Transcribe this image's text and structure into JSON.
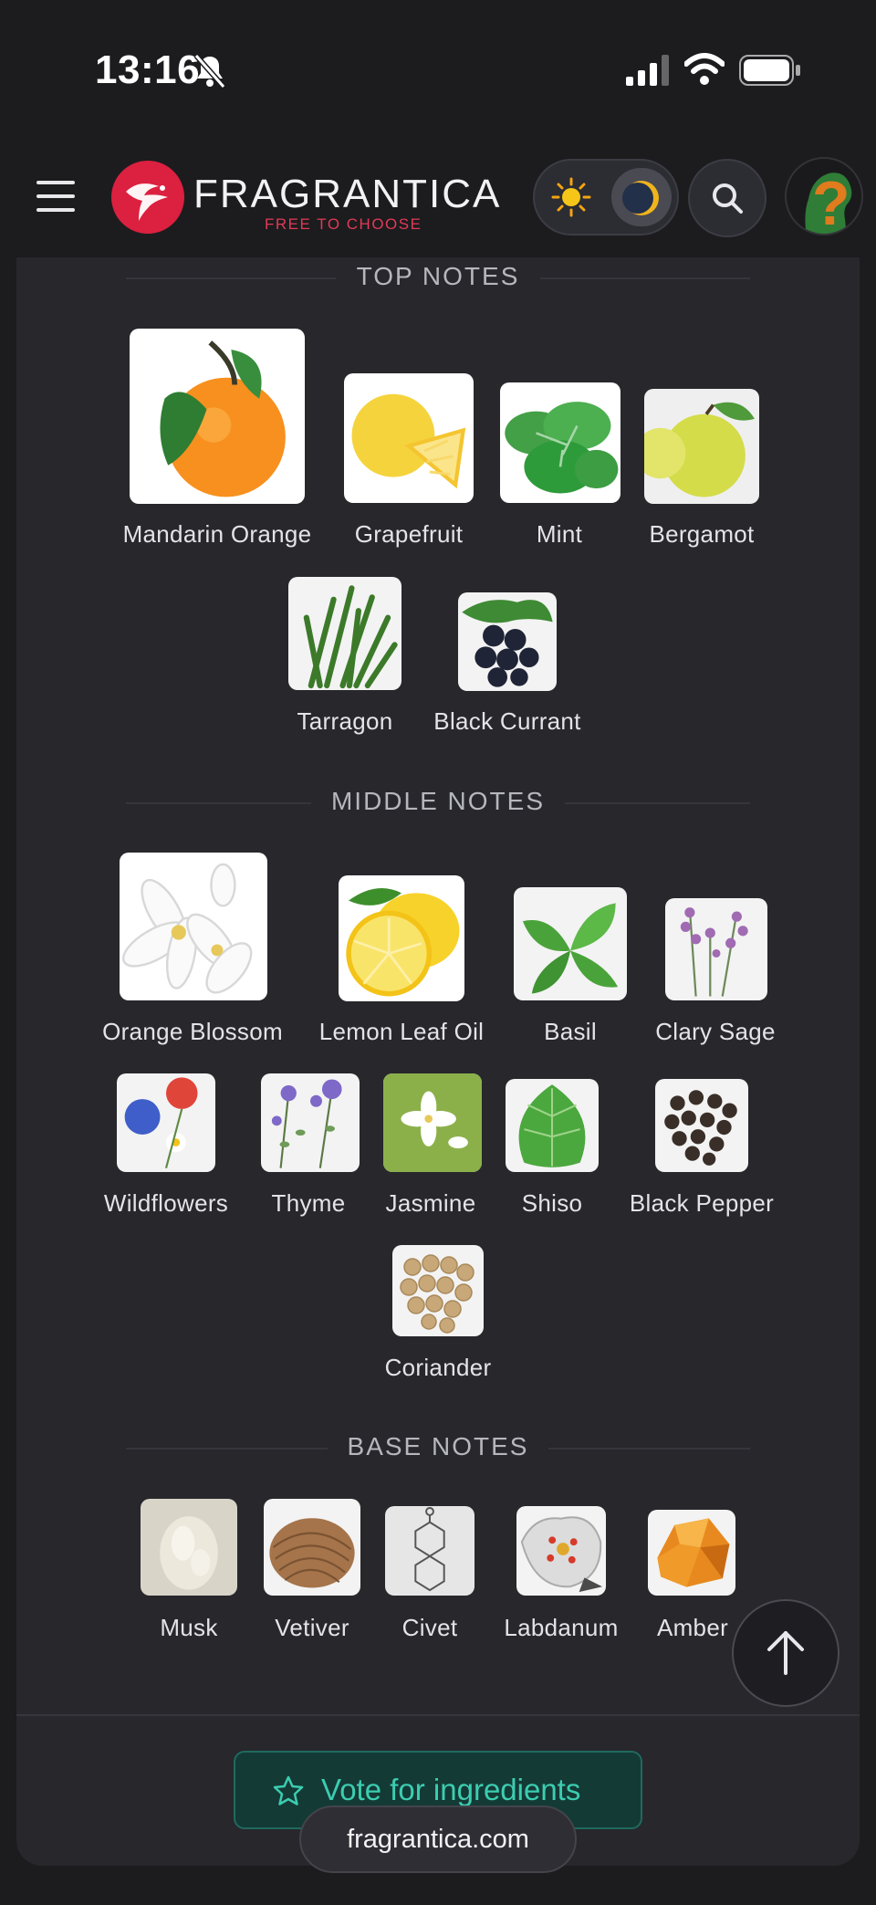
{
  "status_bar": {
    "time": "13:16"
  },
  "header": {
    "logo_text": "FRAGRANTICA",
    "logo_tagline": "FREE TO CHOOSE"
  },
  "sections": {
    "top_title": "TOP NOTES",
    "middle_title": "MIDDLE NOTES",
    "base_title": "BASE NOTES"
  },
  "top_notes": [
    "Mandarin Orange",
    "Grapefruit",
    "Mint",
    "Bergamot",
    "Tarragon",
    "Black Currant"
  ],
  "middle_notes": [
    "Orange Blossom",
    "Lemon Leaf Oil",
    "Basil",
    "Clary Sage",
    "Wildflowers",
    "Thyme",
    "Jasmine",
    "Shiso",
    "Black Pepper",
    "Coriander"
  ],
  "base_notes": [
    "Musk",
    "Vetiver",
    "Civet",
    "Labdanum",
    "Amber"
  ],
  "vote_button": {
    "label": "Vote for ingredients"
  },
  "url_pill": "fragrantica.com",
  "icons": {
    "menu": "menu-icon",
    "search": "search-icon",
    "sun": "sun-icon",
    "moon": "moon-icon",
    "star": "star-icon",
    "scroll_top": "arrow-up-icon"
  },
  "colors": {
    "background": "#1c1c1f",
    "card": "#27272c",
    "brand": "#dc2040",
    "vote_accent": "#3ccdb0"
  }
}
